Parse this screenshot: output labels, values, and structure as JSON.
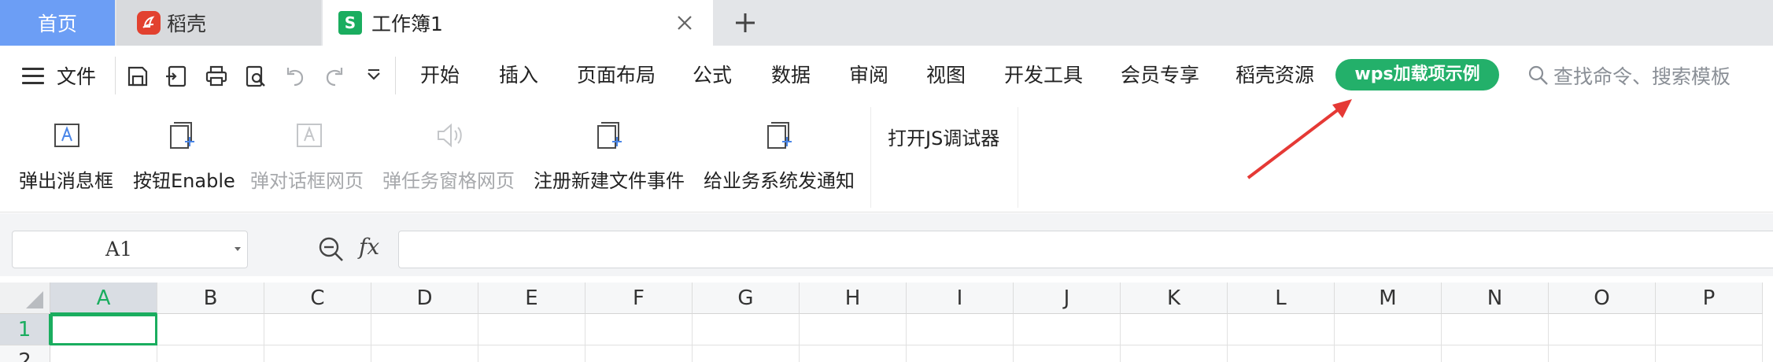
{
  "tabs": {
    "home": "首页",
    "daoke": "稻壳",
    "workbook": "工作簿1",
    "workbook_icon": "S"
  },
  "menu": {
    "file": "文件",
    "items": [
      "开始",
      "插入",
      "页面布局",
      "公式",
      "数据",
      "审阅",
      "视图",
      "开发工具",
      "会员专享",
      "稻壳资源"
    ],
    "active": "wps加载项示例",
    "search_placeholder": "查找命令、搜索模板"
  },
  "ribbon": {
    "buttons": [
      {
        "label": "弹出消息框",
        "enabled": true
      },
      {
        "label": "按钮Enable",
        "enabled": true
      },
      {
        "label": "弹对话框网页",
        "enabled": false
      },
      {
        "label": "弹任务窗格网页",
        "enabled": false
      },
      {
        "label": "注册新建文件事件",
        "enabled": true
      },
      {
        "label": "给业务系统发通知",
        "enabled": true
      }
    ],
    "devtools": "打开JS调试器"
  },
  "formula_bar": {
    "name_box": "A1",
    "fx": "fx",
    "formula": ""
  },
  "grid": {
    "columns": [
      "A",
      "B",
      "C",
      "D",
      "E",
      "F",
      "G",
      "H",
      "I",
      "J",
      "K",
      "L",
      "M",
      "N",
      "O",
      "P"
    ],
    "rows": [
      "1",
      "2"
    ],
    "active_cell": "A1"
  },
  "colors": {
    "accent_green": "#23b06a",
    "home_tab_blue": "#6c9ef5",
    "daoke_red": "#e2412f",
    "annotation_arrow": "#e53935"
  }
}
